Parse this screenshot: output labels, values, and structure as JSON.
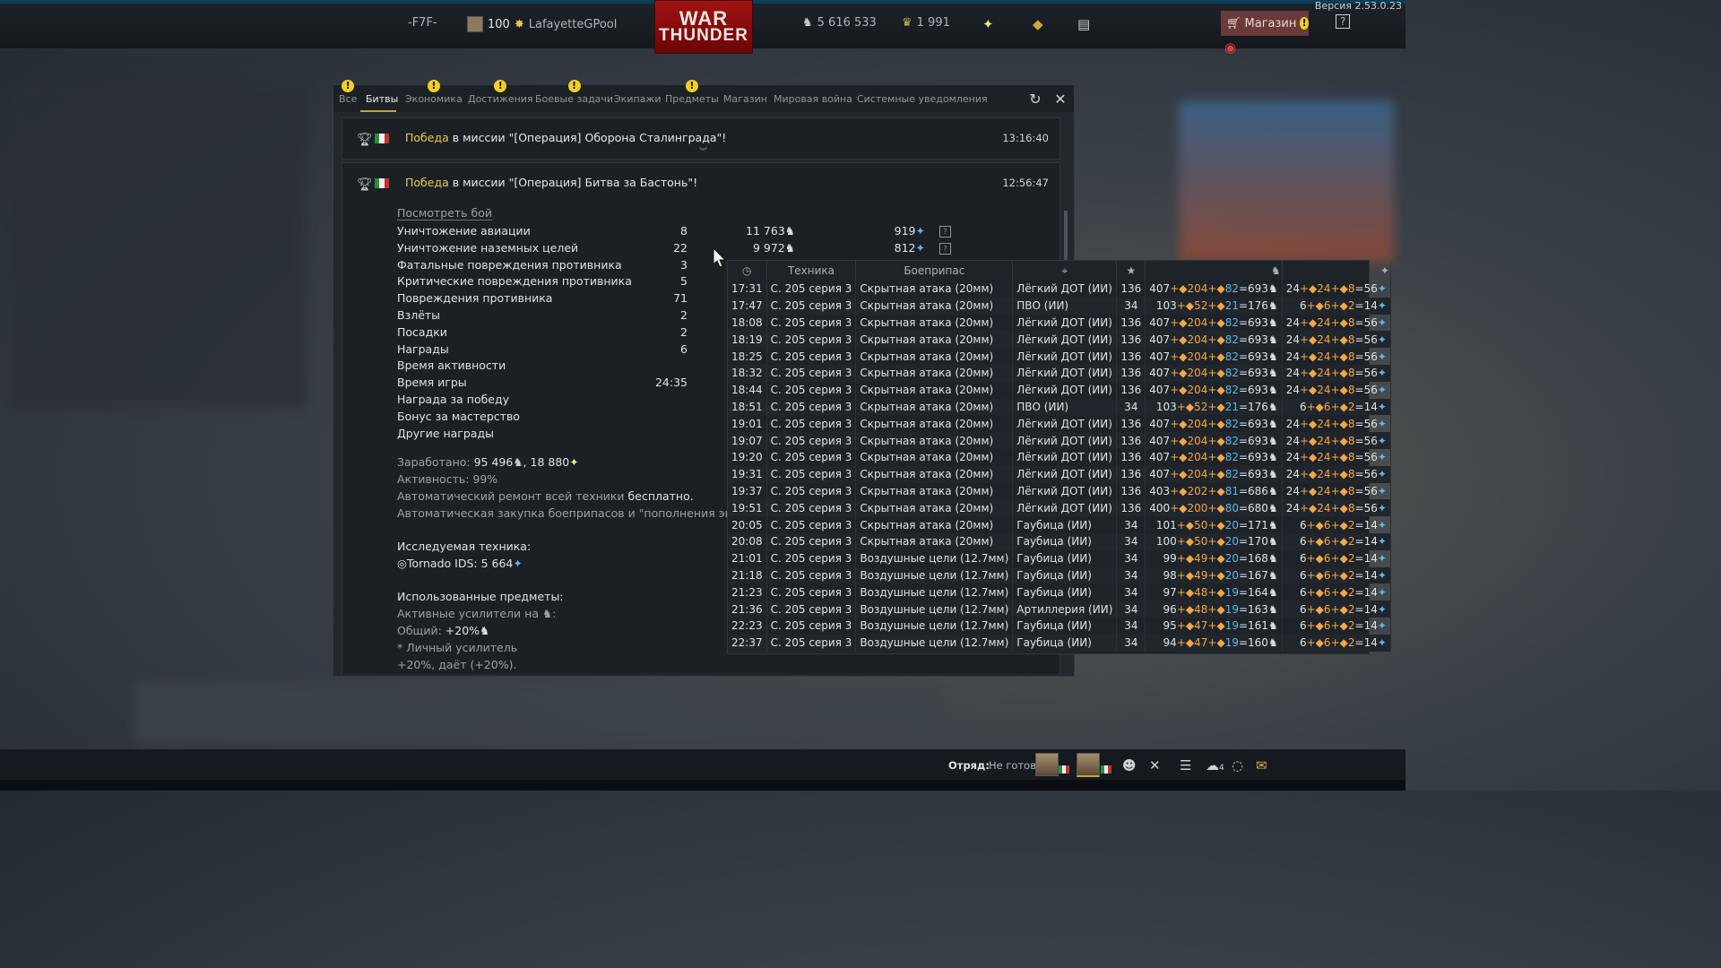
{
  "version": "Версия 2.53.0.23",
  "topbar": {
    "squadron": "-F7F-",
    "level": "100",
    "nickname": "LafayetteGPool",
    "logo_line1": "WAR",
    "logo_line2": "THUNDER",
    "silver_lions": "5 616 533",
    "golden_eagles": "1 991",
    "shop_label": "Магазин",
    "help_label": "?"
  },
  "tabs": [
    {
      "label": "Все",
      "warn": true
    },
    {
      "label": "Битвы",
      "warn": false
    },
    {
      "label": "Экономика",
      "warn": true
    },
    {
      "label": "Достижения",
      "warn": true
    },
    {
      "label": "Боевые задачи",
      "warn": true
    },
    {
      "label": "Экипажи",
      "warn": false
    },
    {
      "label": "Предметы",
      "warn": true
    },
    {
      "label": "Магазин",
      "warn": false
    },
    {
      "label": "Мировая война",
      "warn": false
    },
    {
      "label": "Системные уведомления",
      "warn": false
    }
  ],
  "messages": [
    {
      "win": "Победа",
      "text": " в миссии \"[Операция] Оборона Сталинграда\"!",
      "time": "13:16:40"
    },
    {
      "win": "Победа",
      "text": " в миссии \"[Операция] Битва за Бастонь\"!",
      "time": "12:56:47"
    }
  ],
  "battle": {
    "view_battle": "Посмотреть бой",
    "stats": [
      {
        "label": "Уничтожение авиации",
        "count": "8",
        "sl": "11 763",
        "rp": "919"
      },
      {
        "label": "Уничтожение наземных целей",
        "count": "22",
        "sl": "9 972",
        "rp": "812"
      },
      {
        "label": "Фатальные повреждения противника",
        "count": "3"
      },
      {
        "label": "Критические повреждения противника",
        "count": "5"
      },
      {
        "label": "Повреждения противника",
        "count": "71"
      },
      {
        "label": "Взлёты",
        "count": "2"
      },
      {
        "label": "Посадки",
        "count": "2"
      },
      {
        "label": "Награды",
        "count": "6"
      },
      {
        "label": "Время активности",
        "count": ""
      },
      {
        "label": "Время игры",
        "count": "24:35"
      },
      {
        "label": "Награда за победу",
        "count": ""
      },
      {
        "label": "Бонус за мастерство",
        "count": ""
      },
      {
        "label": "Другие награды",
        "count": ""
      }
    ],
    "earned_label": "Заработано: ",
    "earned_sl": "95 496",
    "earned_rp": "18 880",
    "activity": "Активность: 99%",
    "repair_prefix": "Автоматический ремонт всей техники ",
    "repair_value": "бесплатно.",
    "ammo_refill": "Автоматическая закупка боеприпасов и \"пополнения экипажа\"",
    "research_label": "Исследуемая техника:",
    "research_vehicle": "Tornado IDS: 5 664",
    "items_label": "Использованные предметы:",
    "boosters_label": "Активные усилители на ",
    "general_label": "Общий: ",
    "general_value": "+20%",
    "personal_label": "* Личный усилитель",
    "personal_value": "+20%, даёт (+20%)."
  },
  "tooltip": {
    "headers": {
      "vehicle": "Техника",
      "ammo": "Боеприпас"
    },
    "rows": [
      [
        "17:31",
        "С. 205 серия 3",
        "Скрытная атака (20мм)",
        "Лёгкий ДОТ (ИИ)",
        "136",
        "407",
        "204",
        "82",
        "693",
        "24",
        "24",
        "8",
        "56"
      ],
      [
        "17:47",
        "С. 205 серия 3",
        "Скрытная атака (20мм)",
        "ПВО (ИИ)",
        "34",
        "103",
        "52",
        "21",
        "176",
        "6",
        "6",
        "2",
        "14"
      ],
      [
        "18:08",
        "С. 205 серия 3",
        "Скрытная атака (20мм)",
        "Лёгкий ДОТ (ИИ)",
        "136",
        "407",
        "204",
        "82",
        "693",
        "24",
        "24",
        "8",
        "56"
      ],
      [
        "18:19",
        "С. 205 серия 3",
        "Скрытная атака (20мм)",
        "Лёгкий ДОТ (ИИ)",
        "136",
        "407",
        "204",
        "82",
        "693",
        "24",
        "24",
        "8",
        "56"
      ],
      [
        "18:25",
        "С. 205 серия 3",
        "Скрытная атака (20мм)",
        "Лёгкий ДОТ (ИИ)",
        "136",
        "407",
        "204",
        "82",
        "693",
        "24",
        "24",
        "8",
        "56"
      ],
      [
        "18:32",
        "С. 205 серия 3",
        "Скрытная атака (20мм)",
        "Лёгкий ДОТ (ИИ)",
        "136",
        "407",
        "204",
        "82",
        "693",
        "24",
        "24",
        "8",
        "56"
      ],
      [
        "18:44",
        "С. 205 серия 3",
        "Скрытная атака (20мм)",
        "Лёгкий ДОТ (ИИ)",
        "136",
        "407",
        "204",
        "82",
        "693",
        "24",
        "24",
        "8",
        "56"
      ],
      [
        "18:51",
        "С. 205 серия 3",
        "Скрытная атака (20мм)",
        "ПВО (ИИ)",
        "34",
        "103",
        "52",
        "21",
        "176",
        "6",
        "6",
        "2",
        "14"
      ],
      [
        "19:01",
        "С. 205 серия 3",
        "Скрытная атака (20мм)",
        "Лёгкий ДОТ (ИИ)",
        "136",
        "407",
        "204",
        "82",
        "693",
        "24",
        "24",
        "8",
        "56"
      ],
      [
        "19:07",
        "С. 205 серия 3",
        "Скрытная атака (20мм)",
        "Лёгкий ДОТ (ИИ)",
        "136",
        "407",
        "204",
        "82",
        "693",
        "24",
        "24",
        "8",
        "56"
      ],
      [
        "19:20",
        "С. 205 серия 3",
        "Скрытная атака (20мм)",
        "Лёгкий ДОТ (ИИ)",
        "136",
        "407",
        "204",
        "82",
        "693",
        "24",
        "24",
        "8",
        "56"
      ],
      [
        "19:31",
        "С. 205 серия 3",
        "Скрытная атака (20мм)",
        "Лёгкий ДОТ (ИИ)",
        "136",
        "407",
        "204",
        "82",
        "693",
        "24",
        "24",
        "8",
        "56"
      ],
      [
        "19:37",
        "С. 205 серия 3",
        "Скрытная атака (20мм)",
        "Лёгкий ДОТ (ИИ)",
        "136",
        "403",
        "202",
        "81",
        "686",
        "24",
        "24",
        "8",
        "56"
      ],
      [
        "19:51",
        "С. 205 серия 3",
        "Скрытная атака (20мм)",
        "Лёгкий ДОТ (ИИ)",
        "136",
        "400",
        "200",
        "80",
        "680",
        "24",
        "24",
        "8",
        "56"
      ],
      [
        "20:05",
        "С. 205 серия 3",
        "Скрытная атака (20мм)",
        "Гаубица (ИИ)",
        "34",
        "101",
        "50",
        "20",
        "171",
        "6",
        "6",
        "2",
        "14"
      ],
      [
        "20:08",
        "С. 205 серия 3",
        "Скрытная атака (20мм)",
        "Гаубица (ИИ)",
        "34",
        "100",
        "50",
        "20",
        "170",
        "6",
        "6",
        "2",
        "14"
      ],
      [
        "21:01",
        "С. 205 серия 3",
        "Воздушные цели (12.7мм)",
        "Гаубица (ИИ)",
        "34",
        "99",
        "49",
        "20",
        "168",
        "6",
        "6",
        "2",
        "14"
      ],
      [
        "21:18",
        "С. 205 серия 3",
        "Воздушные цели (12.7мм)",
        "Гаубица (ИИ)",
        "34",
        "98",
        "49",
        "20",
        "167",
        "6",
        "6",
        "2",
        "14"
      ],
      [
        "21:23",
        "С. 205 серия 3",
        "Воздушные цели (12.7мм)",
        "Гаубица (ИИ)",
        "34",
        "97",
        "48",
        "19",
        "164",
        "6",
        "6",
        "2",
        "14"
      ],
      [
        "21:36",
        "С. 205 серия 3",
        "Воздушные цели (12.7мм)",
        "Артиллерия (ИИ)",
        "34",
        "96",
        "48",
        "19",
        "163",
        "6",
        "6",
        "2",
        "14"
      ],
      [
        "22:23",
        "С. 205 серия 3",
        "Воздушные цели (12.7мм)",
        "Гаубица (ИИ)",
        "34",
        "95",
        "47",
        "19",
        "161",
        "6",
        "6",
        "2",
        "14"
      ],
      [
        "22:37",
        "С. 205 серия 3",
        "Воздушные цели (12.7мм)",
        "Гаубица (ИИ)",
        "34",
        "94",
        "47",
        "19",
        "160",
        "6",
        "6",
        "2",
        "14"
      ]
    ]
  },
  "bottombar": {
    "squad_label": "Отряд:",
    "squad_status": "Не готов",
    "friends_count": "4"
  },
  "colors": {
    "accent_gold": "#c8a23d",
    "win": "#f2c94c",
    "warn": "#f3cf23",
    "orange": "#f2a64a",
    "blue": "#5fb6e8"
  }
}
